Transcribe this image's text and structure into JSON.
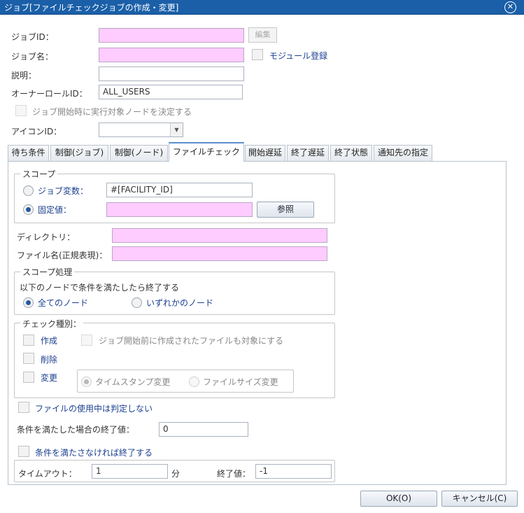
{
  "window": {
    "title": "ジョブ[ファイルチェックジョブの作成・変更]"
  },
  "form": {
    "job_id_label": "ジョブID：",
    "job_id_value": "",
    "edit_button": "編集",
    "job_name_label": "ジョブ名：",
    "job_name_value": "",
    "module_register_label": "モジュール登録",
    "description_label": "説明：",
    "description_value": "",
    "owner_role_label": "オーナーロールID：",
    "owner_role_value": "ALL_USERS",
    "decide_node_label": "ジョブ開始時に実行対象ノードを決定する",
    "icon_id_label": "アイコンID：",
    "icon_id_value": ""
  },
  "tabs": [
    {
      "label": "待ち条件"
    },
    {
      "label": "制御(ジョブ)"
    },
    {
      "label": "制御(ノード)"
    },
    {
      "label": "ファイルチェック"
    },
    {
      "label": "開始遅延"
    },
    {
      "label": "終了遅延"
    },
    {
      "label": "終了状態"
    },
    {
      "label": "通知先の指定"
    }
  ],
  "active_tab": "ファイルチェック",
  "scope": {
    "title": "スコープ",
    "job_variable_label": "ジョブ変数：",
    "job_variable_value": "#[FACILITY_ID]",
    "fixed_value_label": "固定値：",
    "fixed_value_value": "",
    "browse_button": "参照",
    "selected": "fixed"
  },
  "directory_label": "ディレクトリ：",
  "directory_value": "",
  "filename_label": "ファイル名(正規表現)：",
  "filename_value": "",
  "scope_process": {
    "title": "スコープ処理",
    "description": "以下のノードで条件を満たしたら終了する",
    "all_nodes_label": "全てのノード",
    "any_node_label": "いずれかのノード",
    "selected": "all"
  },
  "check_type": {
    "title": "チェック種別：",
    "create_label": "作成",
    "create_prior_label": "ジョブ開始前に作成されたファイルも対象にする",
    "delete_label": "削除",
    "modify_label": "変更",
    "timestamp_label": "タイムスタンプ変更",
    "filesize_label": "ファイルサイズ変更"
  },
  "in_use_label": "ファイルの使用中は判定しない",
  "end_value_label": "条件を満たした場合の終了値：",
  "end_value": "0",
  "exit_if_not_met_label": "条件を満たさなければ終了する",
  "timeout": {
    "timeout_label": "タイムアウト：",
    "timeout_value": "1",
    "unit_label": "分",
    "end_value_label": "終了値：",
    "end_value": "-1"
  },
  "buttons": {
    "ok": "OK(O)",
    "cancel": "キャンセル(C)"
  },
  "colors": {
    "titlebar": "#1a5fa8",
    "required_field": "#ffccff",
    "label_blue": "#1a3f8f"
  }
}
